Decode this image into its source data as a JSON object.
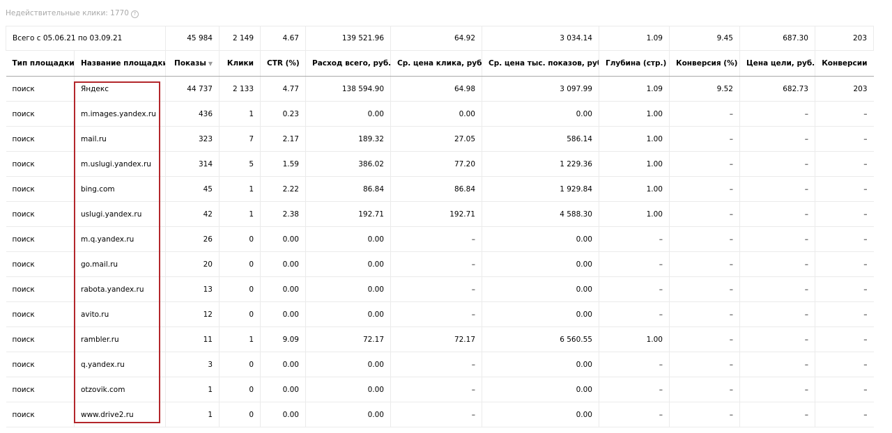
{
  "invalid_clicks": "Недействительные клики: 1770",
  "help_icon": "question-circle-icon",
  "totals": {
    "label": "Всего с 05.06.21 по 03.09.21",
    "impressions": "45 984",
    "clicks": "2 149",
    "ctr": "4.67",
    "spend": "139 521.96",
    "avg_cpc": "64.92",
    "avg_cpm": "3 034.14",
    "depth": "1.09",
    "conversion": "9.45",
    "goal_cost": "687.30",
    "conversions": "203"
  },
  "columns": {
    "type": "Тип площадки",
    "site": "Название площадки",
    "impressions": "Показы",
    "clicks": "Клики",
    "ctr": "CTR (%)",
    "spend": "Расход всего, руб.",
    "avg_cpc": "Ср. цена клика, руб.",
    "avg_cpm": "Ср. цена тыс. показов, руб.",
    "depth": "Глубина (стр.)",
    "conversion": "Конверсия (%)",
    "goal_cost": "Цена цели, руб.",
    "conversions": "Конверсии"
  },
  "sort_indicator": "▼",
  "rows": [
    {
      "type": "поиск",
      "site": "Яндекс",
      "impressions": "44 737",
      "clicks": "2 133",
      "ctr": "4.77",
      "spend": "138 594.90",
      "avg_cpc": "64.98",
      "avg_cpm": "3 097.99",
      "depth": "1.09",
      "conversion": "9.52",
      "goal_cost": "682.73",
      "conversions": "203"
    },
    {
      "type": "поиск",
      "site": "m.images.yandex.ru",
      "impressions": "436",
      "clicks": "1",
      "ctr": "0.23",
      "spend": "0.00",
      "avg_cpc": "0.00",
      "avg_cpm": "0.00",
      "depth": "1.00",
      "conversion": "–",
      "goal_cost": "–",
      "conversions": "–"
    },
    {
      "type": "поиск",
      "site": "mail.ru",
      "impressions": "323",
      "clicks": "7",
      "ctr": "2.17",
      "spend": "189.32",
      "avg_cpc": "27.05",
      "avg_cpm": "586.14",
      "depth": "1.00",
      "conversion": "–",
      "goal_cost": "–",
      "conversions": "–"
    },
    {
      "type": "поиск",
      "site": "m.uslugi.yandex.ru",
      "impressions": "314",
      "clicks": "5",
      "ctr": "1.59",
      "spend": "386.02",
      "avg_cpc": "77.20",
      "avg_cpm": "1 229.36",
      "depth": "1.00",
      "conversion": "–",
      "goal_cost": "–",
      "conversions": "–"
    },
    {
      "type": "поиск",
      "site": "bing.com",
      "impressions": "45",
      "clicks": "1",
      "ctr": "2.22",
      "spend": "86.84",
      "avg_cpc": "86.84",
      "avg_cpm": "1 929.84",
      "depth": "1.00",
      "conversion": "–",
      "goal_cost": "–",
      "conversions": "–"
    },
    {
      "type": "поиск",
      "site": "uslugi.yandex.ru",
      "impressions": "42",
      "clicks": "1",
      "ctr": "2.38",
      "spend": "192.71",
      "avg_cpc": "192.71",
      "avg_cpm": "4 588.30",
      "depth": "1.00",
      "conversion": "–",
      "goal_cost": "–",
      "conversions": "–"
    },
    {
      "type": "поиск",
      "site": "m.q.yandex.ru",
      "impressions": "26",
      "clicks": "0",
      "ctr": "0.00",
      "spend": "0.00",
      "avg_cpc": "–",
      "avg_cpm": "0.00",
      "depth": "–",
      "conversion": "–",
      "goal_cost": "–",
      "conversions": "–"
    },
    {
      "type": "поиск",
      "site": "go.mail.ru",
      "impressions": "20",
      "clicks": "0",
      "ctr": "0.00",
      "spend": "0.00",
      "avg_cpc": "–",
      "avg_cpm": "0.00",
      "depth": "–",
      "conversion": "–",
      "goal_cost": "–",
      "conversions": "–"
    },
    {
      "type": "поиск",
      "site": "rabota.yandex.ru",
      "impressions": "13",
      "clicks": "0",
      "ctr": "0.00",
      "spend": "0.00",
      "avg_cpc": "–",
      "avg_cpm": "0.00",
      "depth": "–",
      "conversion": "–",
      "goal_cost": "–",
      "conversions": "–"
    },
    {
      "type": "поиск",
      "site": "avito.ru",
      "impressions": "12",
      "clicks": "0",
      "ctr": "0.00",
      "spend": "0.00",
      "avg_cpc": "–",
      "avg_cpm": "0.00",
      "depth": "–",
      "conversion": "–",
      "goal_cost": "–",
      "conversions": "–"
    },
    {
      "type": "поиск",
      "site": "rambler.ru",
      "impressions": "11",
      "clicks": "1",
      "ctr": "9.09",
      "spend": "72.17",
      "avg_cpc": "72.17",
      "avg_cpm": "6 560.55",
      "depth": "1.00",
      "conversion": "–",
      "goal_cost": "–",
      "conversions": "–"
    },
    {
      "type": "поиск",
      "site": "q.yandex.ru",
      "impressions": "3",
      "clicks": "0",
      "ctr": "0.00",
      "spend": "0.00",
      "avg_cpc": "–",
      "avg_cpm": "0.00",
      "depth": "–",
      "conversion": "–",
      "goal_cost": "–",
      "conversions": "–"
    },
    {
      "type": "поиск",
      "site": "otzovik.com",
      "impressions": "1",
      "clicks": "0",
      "ctr": "0.00",
      "spend": "0.00",
      "avg_cpc": "–",
      "avg_cpm": "0.00",
      "depth": "–",
      "conversion": "–",
      "goal_cost": "–",
      "conversions": "–"
    },
    {
      "type": "поиск",
      "site": "www.drive2.ru",
      "impressions": "1",
      "clicks": "0",
      "ctr": "0.00",
      "spend": "0.00",
      "avg_cpc": "–",
      "avg_cpm": "0.00",
      "depth": "–",
      "conversion": "–",
      "goal_cost": "–",
      "conversions": "–"
    }
  ],
  "highlight_color": "#b3262b"
}
